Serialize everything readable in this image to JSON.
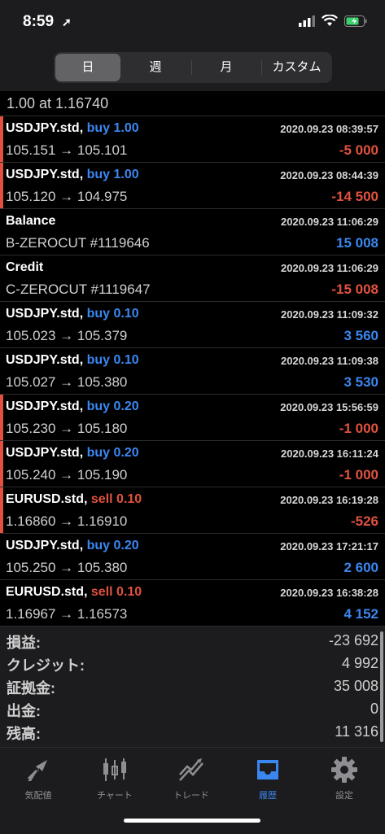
{
  "status_bar": {
    "time": "8:59"
  },
  "segments": [
    "日",
    "週",
    "月",
    "カスタム"
  ],
  "partial_row": "1.00 at 1.16740",
  "trades": [
    {
      "symbol": "USDJPY.std,",
      "side": "buy",
      "volume": "1.00",
      "side_text": "buy 1.00",
      "date": "2020.09.23 08:39:57",
      "prices": "105.151 → 105.101",
      "profit": "-5 000",
      "bar": true
    },
    {
      "symbol": "USDJPY.std,",
      "side": "buy",
      "volume": "1.00",
      "side_text": "buy 1.00",
      "date": "2020.09.23 08:44:39",
      "prices": "105.120 → 104.975",
      "profit": "-14 500",
      "bar": true
    },
    {
      "symbol": "Balance",
      "side": "",
      "side_text": "",
      "date": "2020.09.23 11:06:29",
      "prices": "B-ZEROCUT #1119646",
      "profit": "15 008",
      "bar": false
    },
    {
      "symbol": "Credit",
      "side": "",
      "side_text": "",
      "date": "2020.09.23 11:06:29",
      "prices": "C-ZEROCUT #1119647",
      "profit": "-15 008",
      "bar": false
    },
    {
      "symbol": "USDJPY.std,",
      "side": "buy",
      "side_text": "buy 0.10",
      "date": "2020.09.23 11:09:32",
      "prices": "105.023 → 105.379",
      "profit": "3 560",
      "bar": false
    },
    {
      "symbol": "USDJPY.std,",
      "side": "buy",
      "side_text": "buy 0.10",
      "date": "2020.09.23 11:09:38",
      "prices": "105.027 → 105.380",
      "profit": "3 530",
      "bar": false
    },
    {
      "symbol": "USDJPY.std,",
      "side": "buy",
      "side_text": "buy 0.20",
      "date": "2020.09.23 15:56:59",
      "prices": "105.230 → 105.180",
      "profit": "-1 000",
      "bar": true
    },
    {
      "symbol": "USDJPY.std,",
      "side": "buy",
      "side_text": "buy 0.20",
      "date": "2020.09.23 16:11:24",
      "prices": "105.240 → 105.190",
      "profit": "-1 000",
      "bar": true
    },
    {
      "symbol": "EURUSD.std,",
      "side": "sell",
      "side_text": "sell 0.10",
      "date": "2020.09.23 16:19:28",
      "prices": "1.16860 → 1.16910",
      "profit": "-526",
      "bar": true
    },
    {
      "symbol": "USDJPY.std,",
      "side": "buy",
      "side_text": "buy 0.20",
      "date": "2020.09.23 17:21:17",
      "prices": "105.250 → 105.380",
      "profit": "2 600",
      "bar": false
    },
    {
      "symbol": "EURUSD.std,",
      "side": "sell",
      "side_text": "sell 0.10",
      "date": "2020.09.23 16:38:28",
      "prices": "1.16967 → 1.16573",
      "profit": "4 152",
      "bar": false
    }
  ],
  "summary": [
    {
      "label": "損益:",
      "value": "-23 692"
    },
    {
      "label": "クレジット:",
      "value": "4 992"
    },
    {
      "label": "証拠金:",
      "value": "35 008"
    },
    {
      "label": "出金:",
      "value": "0"
    },
    {
      "label": "残高:",
      "value": "11 316"
    }
  ],
  "tabs": [
    {
      "label": "気配値",
      "icon": "quotes-icon",
      "active": false
    },
    {
      "label": "チャート",
      "icon": "chart-icon",
      "active": false
    },
    {
      "label": "トレード",
      "icon": "trade-icon",
      "active": false
    },
    {
      "label": "履歴",
      "icon": "history-icon",
      "active": true
    },
    {
      "label": "設定",
      "icon": "settings-icon",
      "active": false
    }
  ],
  "colors": {
    "accent": "#3b87f0",
    "loss": "#e0523f",
    "background": "#000000"
  }
}
